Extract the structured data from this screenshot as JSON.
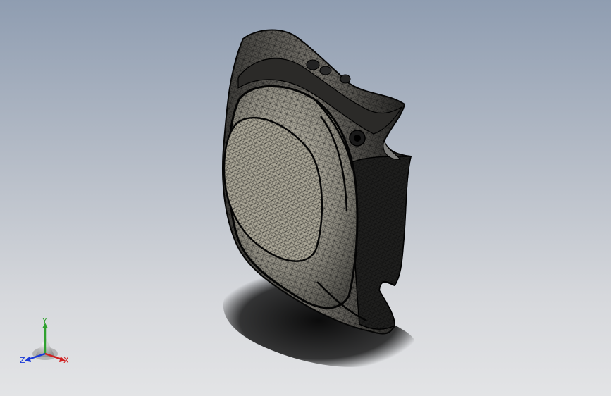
{
  "viewport": {
    "background_top": "#8f9db1",
    "background_bottom": "#e3e4e6",
    "model": {
      "display_mode": "wireframe-mesh",
      "mesh_color": "#0a0a0a",
      "fill_color": "#8e8b80"
    }
  },
  "triad": {
    "x_label": "X",
    "y_label": "Y",
    "z_label": "Z",
    "x_color": "#d02020",
    "y_color": "#2fa12f",
    "z_color": "#1a3ad8"
  }
}
